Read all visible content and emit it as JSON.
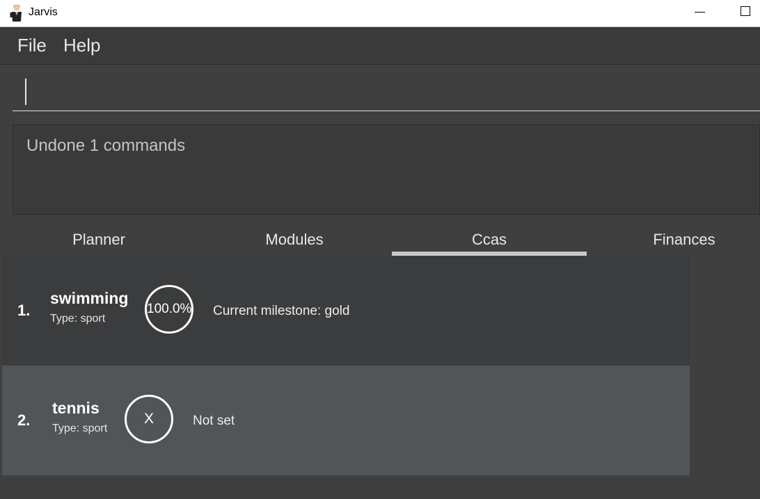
{
  "window": {
    "title": "Jarvis"
  },
  "menu": {
    "file": "File",
    "help": "Help"
  },
  "command": {
    "value": ""
  },
  "result": {
    "text": "Undone 1 commands"
  },
  "tabs": [
    {
      "label": "Planner",
      "selected": false
    },
    {
      "label": "Modules",
      "selected": false
    },
    {
      "label": "Ccas",
      "selected": true
    },
    {
      "label": "Finances",
      "selected": false
    }
  ],
  "ccas": [
    {
      "index": "1.",
      "name": "swimming",
      "type": "Type: sport",
      "progress": "100.0%",
      "milestone": "Current milestone: gold"
    },
    {
      "index": "2.",
      "name": "tennis",
      "type": "Type: sport",
      "progress": "X",
      "milestone": "Not set"
    }
  ],
  "colors": {
    "background": "#3f3f3f",
    "row_dark": "#3b3c3e",
    "row_light": "#515557",
    "accent": "#c8c8c8"
  },
  "icons": {
    "app": "butler-icon",
    "minimize": "minimize-icon",
    "maximize": "maximize-icon"
  }
}
